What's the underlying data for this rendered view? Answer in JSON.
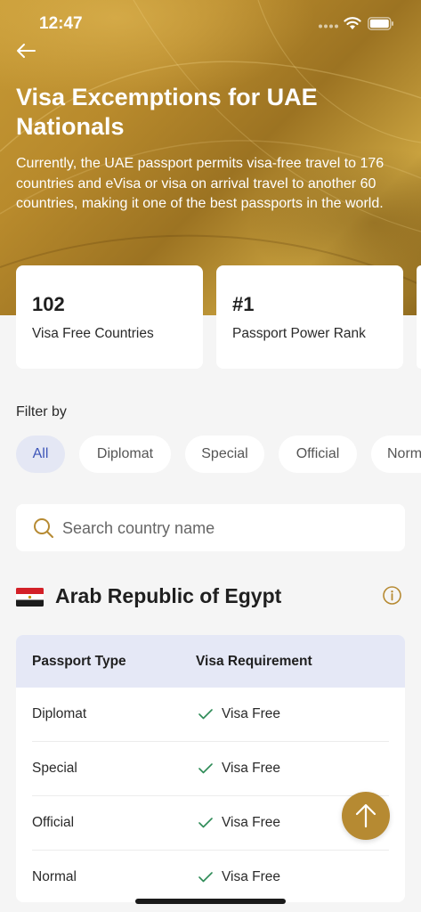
{
  "status_bar": {
    "time": "12:47"
  },
  "header": {
    "title": "Visa Excemptions for UAE Nationals",
    "description": "Currently, the UAE passport permits visa-free travel to 176 countries and eVisa or visa on arrival travel to another 60 countries, making it one of the best passports in the world."
  },
  "stats": [
    {
      "value": "102",
      "label": "Visa Free Countries"
    },
    {
      "value": "#1",
      "label": "Passport Power Rank"
    }
  ],
  "filter": {
    "label": "Filter by",
    "chips": [
      "All",
      "Diplomat",
      "Special",
      "Official",
      "Normal"
    ],
    "selected": "All"
  },
  "search": {
    "placeholder": "Search country name"
  },
  "country": {
    "name": "Arab Republic of Egypt",
    "table": {
      "headers": [
        "Passport Type",
        "Visa Requirement"
      ],
      "rows": [
        {
          "type": "Diplomat",
          "requirement": "Visa Free"
        },
        {
          "type": "Special",
          "requirement": "Visa Free"
        },
        {
          "type": "Official",
          "requirement": "Visa Free"
        },
        {
          "type": "Normal",
          "requirement": "Visa Free"
        }
      ]
    }
  },
  "icons": {
    "back": "arrow-left-icon",
    "search": "search-icon",
    "info": "info-icon",
    "check": "check-icon",
    "scroll_top": "arrow-up-icon"
  },
  "colors": {
    "gold": "#b68a32",
    "chip_active_bg": "#e4e7f4",
    "chip_active_text": "#3e56b8",
    "check": "#2e8b57",
    "table_header_bg": "#e5e8f6"
  }
}
